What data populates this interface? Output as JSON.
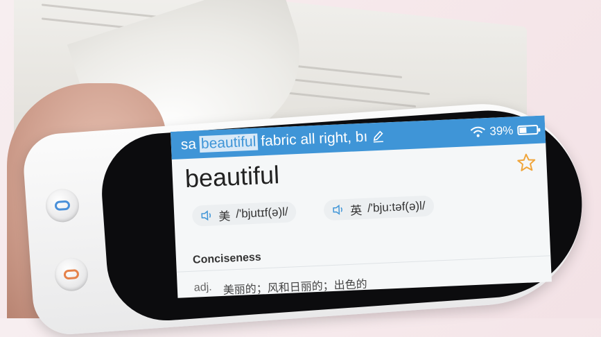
{
  "scan": {
    "prefix": "sa",
    "highlight": "beautiful",
    "suffix": "fabric all right, bı"
  },
  "status": {
    "battery": "39%",
    "battery_level": 0.39
  },
  "entry": {
    "word": "beautiful",
    "pronunciations": [
      {
        "region": "美",
        "ipa": "/'bjutɪf(ə)l/"
      },
      {
        "region": "英",
        "ipa": "/'bju:təf(ə)l/"
      }
    ],
    "section": "Conciseness",
    "definition": {
      "pos": "adj.",
      "text": "美丽的；风和日丽的；出色的"
    }
  },
  "colors": {
    "accent": "#3f95d7",
    "star": "#f0a53a",
    "side_button_top": "#4a90d9",
    "side_button_bottom": "#e5824a"
  },
  "icons": [
    "edit-icon",
    "wifi-icon",
    "battery-icon",
    "star-icon",
    "speaker-icon"
  ]
}
